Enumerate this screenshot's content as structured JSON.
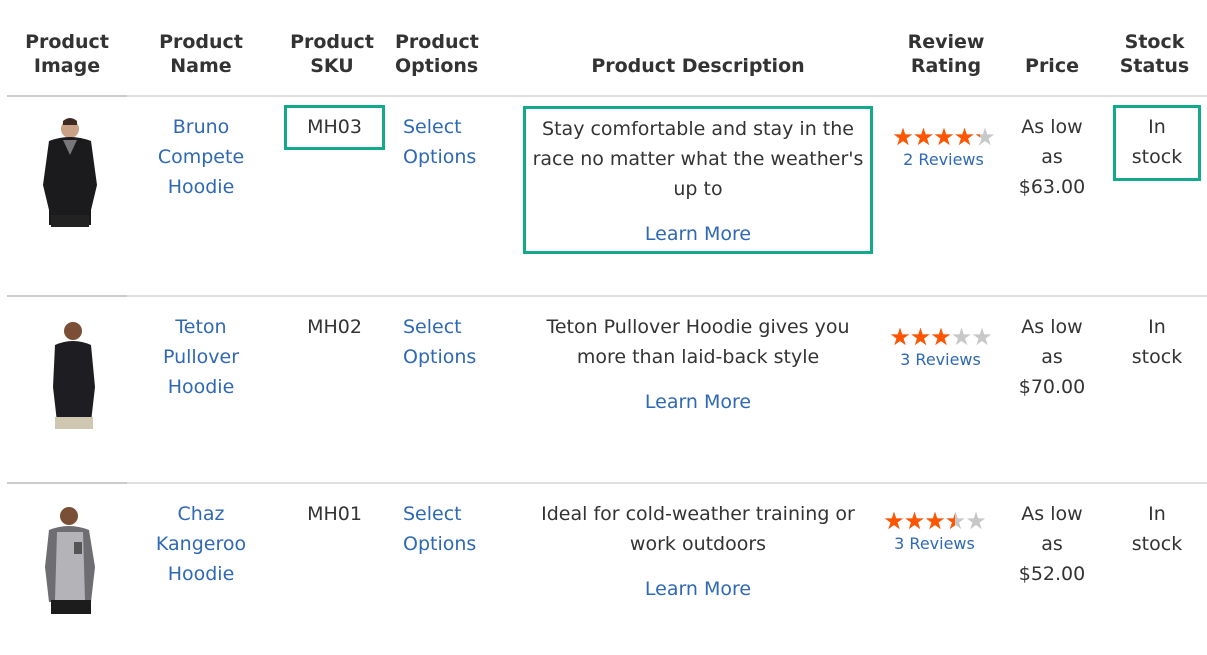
{
  "table": {
    "headers": {
      "image": [
        "Product",
        "Image"
      ],
      "name": [
        "Product",
        "Name"
      ],
      "sku": [
        "Product",
        "SKU"
      ],
      "options": [
        "Product",
        "Options"
      ],
      "description": [
        "Product Description"
      ],
      "rating": [
        "Review",
        "Rating"
      ],
      "price": [
        "Price"
      ],
      "stock": [
        "Stock",
        "Status"
      ]
    },
    "rows": [
      {
        "image_alt": "Bruno Compete Hoodie image",
        "name": [
          "Bruno",
          "Compete",
          "Hoodie"
        ],
        "sku": "MH03",
        "options": [
          "Select",
          "Options"
        ],
        "description": [
          "Stay comfortable and stay in the",
          "race no matter what the weather's",
          "up to"
        ],
        "learn_more": "Learn More",
        "rating_percent": 86,
        "reviews": "2 Reviews",
        "price": [
          "As low",
          "as",
          "$63.00"
        ],
        "stock": [
          "In",
          "stock"
        ],
        "highlighted": [
          "sku",
          "description",
          "stock"
        ]
      },
      {
        "image_alt": "Teton Pullover Hoodie image",
        "name": [
          "Teton",
          "Pullover",
          "Hoodie"
        ],
        "sku": "MH02",
        "options": [
          "Select",
          "Options"
        ],
        "description": [
          "Teton Pullover Hoodie gives you",
          "more than laid-back style"
        ],
        "learn_more": "Learn More",
        "rating_percent": 60,
        "reviews": "3 Reviews",
        "price": [
          "As low",
          "as",
          "$70.00"
        ],
        "stock": [
          "In",
          "stock"
        ],
        "highlighted": []
      },
      {
        "image_alt": "Chaz Kangeroo Hoodie image",
        "name": [
          "Chaz",
          "Kangeroo",
          "Hoodie"
        ],
        "sku": "MH01",
        "options": [
          "Select",
          "Options"
        ],
        "description": [
          "Ideal for cold-weather training or",
          "work outdoors"
        ],
        "learn_more": "Learn More",
        "rating_percent": 70,
        "reviews": "3 Reviews",
        "price": [
          "As low",
          "as",
          "$52.00"
        ],
        "stock": [
          "In",
          "stock"
        ],
        "highlighted": []
      }
    ],
    "star_glyphs": "★★★★★",
    "colors": {
      "link": "#2f68b4",
      "star_active": "#ff5501",
      "star_inactive": "#c8c8c8",
      "highlight": "#13a98b"
    }
  }
}
